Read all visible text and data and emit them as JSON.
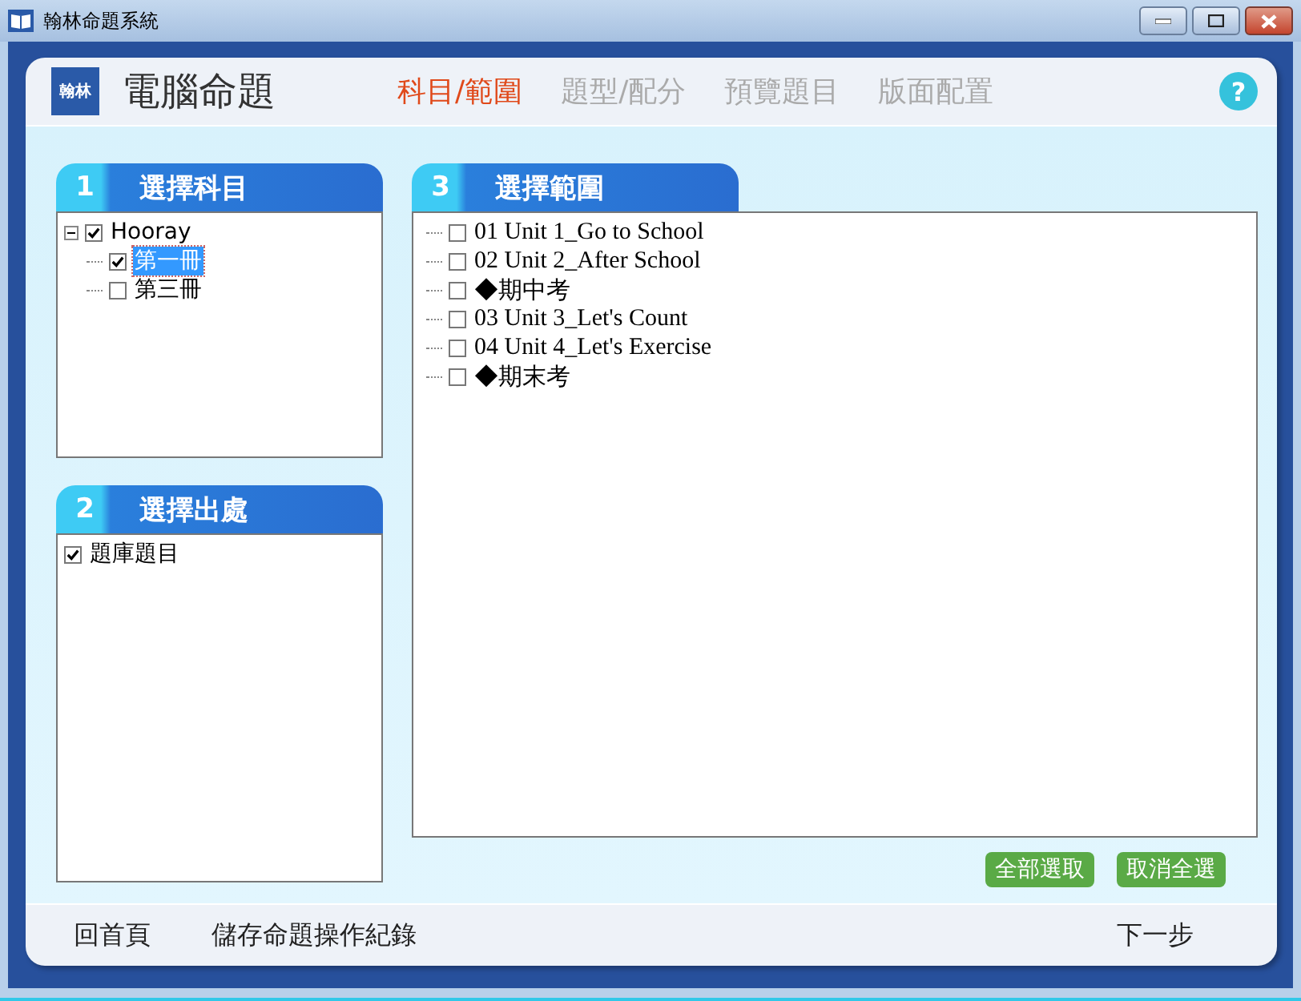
{
  "window": {
    "title": "翰林命題系統"
  },
  "header": {
    "logo_text": "翰林",
    "title": "電腦命題",
    "help": "?"
  },
  "steps": [
    {
      "label": "科目/範圍",
      "selected": true
    },
    {
      "label": "題型/配分",
      "selected": false
    },
    {
      "label": "預覽題目",
      "selected": false
    },
    {
      "label": "版面配置",
      "selected": false
    }
  ],
  "subject_panel": {
    "number": "1",
    "title": "選擇科目",
    "tree": [
      {
        "label": "Hooray",
        "checked": true,
        "expanded": true,
        "selected": false,
        "children": [
          {
            "label": "第一冊",
            "checked": true,
            "selected": true
          },
          {
            "label": "第三冊",
            "checked": false,
            "selected": false
          }
        ]
      }
    ]
  },
  "source_panel": {
    "number": "2",
    "title": "選擇出處",
    "items": [
      {
        "label": "題庫題目",
        "checked": true
      }
    ]
  },
  "range_panel": {
    "number": "3",
    "title": "選擇範圍",
    "items": [
      {
        "label": "01 Unit 1_Go to School",
        "checked": false
      },
      {
        "label": "02 Unit 2_After School",
        "checked": false
      },
      {
        "label": " ◆期中考",
        "checked": false
      },
      {
        "label": "03 Unit 3_Let's Count",
        "checked": false
      },
      {
        "label": "04 Unit 4_Let's Exercise",
        "checked": false
      },
      {
        "label": " ◆期末考",
        "checked": false
      }
    ]
  },
  "range_buttons": [
    "全部選取",
    "取消全選"
  ],
  "footer": {
    "left": [
      "回首頁",
      "儲存命題操作紀錄"
    ],
    "next": "下一步"
  }
}
